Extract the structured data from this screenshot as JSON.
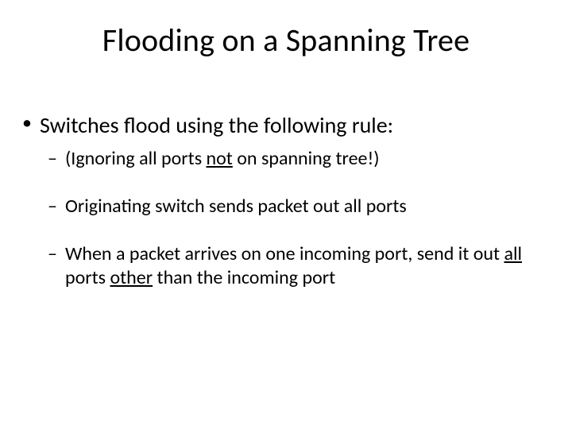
{
  "title": "Flooding on a Spanning Tree",
  "bullets": {
    "lvl1_0": "Switches flood using the following rule:",
    "lvl2_0_pre": "(Ignoring all ports ",
    "lvl2_0_u": "not",
    "lvl2_0_post": " on spanning tree!)",
    "lvl2_1": "Originating switch sends packet out all ports",
    "lvl2_2_pre": "When a packet arrives on one incoming port, send it out ",
    "lvl2_2_u1": "all",
    "lvl2_2_mid": " ports ",
    "lvl2_2_u2": "other",
    "lvl2_2_post": " than the incoming port"
  }
}
